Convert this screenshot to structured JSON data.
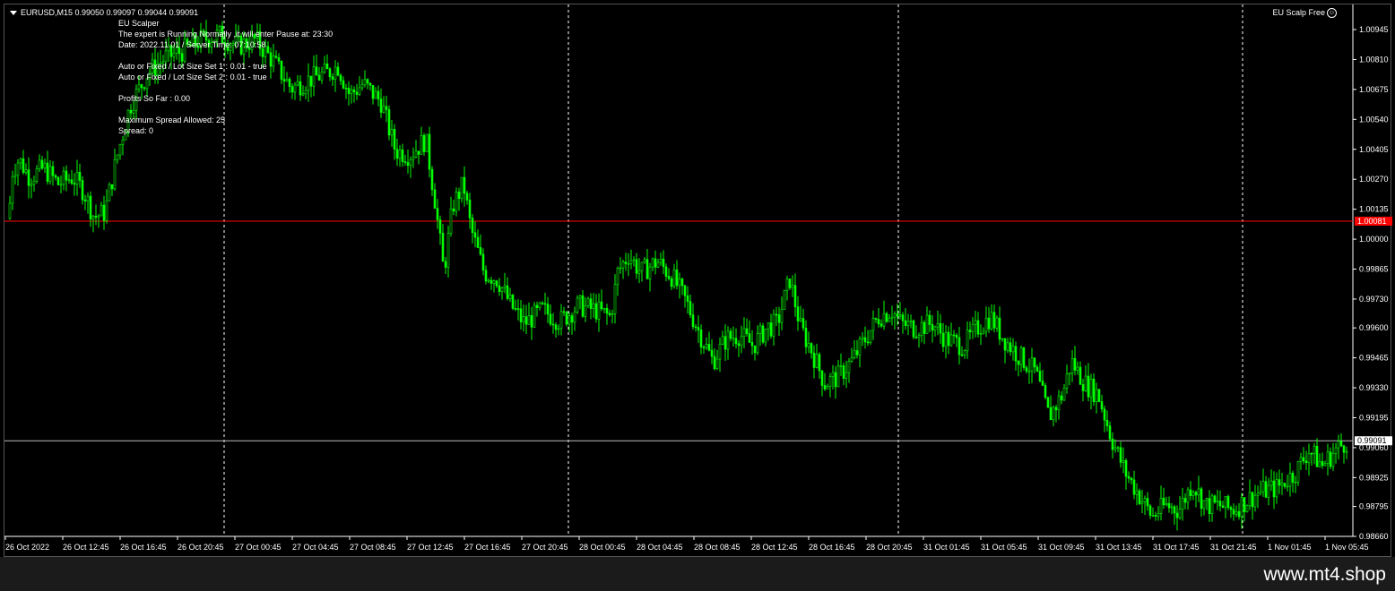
{
  "window": {
    "symbol_title": "EURUSD,M15  0.99050 0.99097 0.99044 0.99091",
    "ea_label": "EU Scalp Free",
    "ea_icon": "smiley-icon"
  },
  "info_panel": {
    "lines": [
      "EU Scalper",
      "The expert is Running Normally ,it will enter Pause at: 23:30",
      "Date: 2022.11.01 / Server Time: 07:10:58",
      "",
      "Auto or Fixed / Lot Size Set 1 : 0.01 - true",
      "Auto or Fixed / Lot Size Set 2 : 0.01 - true",
      "",
      "Profits So Far : 0.00",
      "",
      "Maximum Spread Allowed: 25",
      "Spread: 0"
    ]
  },
  "price_axis": {
    "ticks": [
      "1.00945",
      "1.00810",
      "1.00675",
      "1.00540",
      "1.00405",
      "1.00270",
      "1.00135",
      "1.00000",
      "0.99865",
      "0.99730",
      "0.99600",
      "0.99465",
      "0.99330",
      "0.99195",
      "0.99060",
      "0.98925",
      "0.98795",
      "0.98660"
    ],
    "red_line_label": "1.00081",
    "current_price_label": "0.99091"
  },
  "time_axis": {
    "labels": [
      "26 Oct 2022",
      "26 Oct 12:45",
      "26 Oct 16:45",
      "26 Oct 20:45",
      "27 Oct 00:45",
      "27 Oct 04:45",
      "27 Oct 08:45",
      "27 Oct 12:45",
      "27 Oct 16:45",
      "27 Oct 20:45",
      "28 Oct 00:45",
      "28 Oct 04:45",
      "28 Oct 08:45",
      "28 Oct 12:45",
      "28 Oct 16:45",
      "28 Oct 20:45",
      "31 Oct 01:45",
      "31 Oct 05:45",
      "31 Oct 09:45",
      "31 Oct 13:45",
      "31 Oct 17:45",
      "31 Oct 21:45",
      "1 Nov 01:45",
      "1 Nov 05:45"
    ]
  },
  "colors": {
    "background": "#000000",
    "candles": "#00ff00",
    "red_line": "#ff0000",
    "grid": "#ffffff"
  },
  "chart_data": {
    "type": "candlestick",
    "instrument": "EURUSD",
    "timeframe": "M15",
    "ylim": [
      0.9866,
      1.00945
    ],
    "red_line": 1.00081,
    "current_price": 0.99091,
    "close_path": [
      [
        0,
        0.9975
      ],
      [
        8,
        1.003
      ],
      [
        16,
        1.0036
      ],
      [
        28,
        1.0028
      ],
      [
        44,
        1.0032
      ],
      [
        60,
        1.0025
      ],
      [
        76,
        1.0028
      ],
      [
        88,
        1.0022
      ],
      [
        100,
        1.001
      ],
      [
        112,
        1.0012
      ],
      [
        126,
        1.0038
      ],
      [
        140,
        1.006
      ],
      [
        160,
        1.0075
      ],
      [
        180,
        1.0082
      ],
      [
        200,
        1.0085
      ],
      [
        220,
        1.009
      ],
      [
        240,
        1.0092
      ],
      [
        260,
        1.0087
      ],
      [
        280,
        1.009
      ],
      [
        300,
        1.008
      ],
      [
        320,
        1.0068
      ],
      [
        340,
        1.0072
      ],
      [
        360,
        1.0075
      ],
      [
        372,
        1.0078
      ],
      [
        385,
        1.0065
      ],
      [
        400,
        1.007
      ],
      [
        420,
        1.0062
      ],
      [
        436,
        1.004
      ],
      [
        452,
        1.0038
      ],
      [
        470,
        1.0045
      ],
      [
        480,
        1.0018
      ],
      [
        490,
        0.9985
      ],
      [
        500,
        1.0015
      ],
      [
        512,
        1.0025
      ],
      [
        520,
        1.0005
      ],
      [
        535,
        0.9985
      ],
      [
        550,
        0.9982
      ],
      [
        565,
        0.997
      ],
      [
        580,
        0.9962
      ],
      [
        600,
        0.9968
      ],
      [
        620,
        0.9963
      ],
      [
        640,
        0.997
      ],
      [
        660,
        0.9968
      ],
      [
        676,
        0.9965
      ],
      [
        684,
        0.9985
      ],
      [
        696,
        0.9993
      ],
      [
        710,
        0.9985
      ],
      [
        728,
        0.999
      ],
      [
        745,
        0.9983
      ],
      [
        760,
        0.9972
      ],
      [
        775,
        0.9958
      ],
      [
        790,
        0.9945
      ],
      [
        805,
        0.9955
      ],
      [
        820,
        0.9957
      ],
      [
        835,
        0.9952
      ],
      [
        850,
        0.996
      ],
      [
        862,
        0.9962
      ],
      [
        876,
        0.9982
      ],
      [
        888,
        0.996
      ],
      [
        900,
        0.995
      ],
      [
        915,
        0.9935
      ],
      [
        930,
        0.9938
      ],
      [
        945,
        0.9945
      ],
      [
        960,
        0.9955
      ],
      [
        975,
        0.9965
      ],
      [
        990,
        0.9968
      ],
      [
        1000,
        0.9962
      ],
      [
        1015,
        0.996
      ],
      [
        1035,
        0.9962
      ],
      [
        1050,
        0.9955
      ],
      [
        1070,
        0.9952
      ],
      [
        1085,
        0.996
      ],
      [
        1100,
        0.9965
      ],
      [
        1115,
        0.9955
      ],
      [
        1130,
        0.9948
      ],
      [
        1150,
        0.994
      ],
      [
        1165,
        0.992
      ],
      [
        1180,
        0.993
      ],
      [
        1190,
        0.9945
      ],
      [
        1205,
        0.9935
      ],
      [
        1220,
        0.993
      ],
      [
        1235,
        0.991
      ],
      [
        1250,
        0.9895
      ],
      [
        1265,
        0.9885
      ],
      [
        1280,
        0.9875
      ],
      [
        1295,
        0.988
      ],
      [
        1310,
        0.9878
      ],
      [
        1325,
        0.989
      ],
      [
        1340,
        0.988
      ],
      [
        1355,
        0.988
      ],
      [
        1370,
        0.9878
      ],
      [
        1385,
        0.9882
      ],
      [
        1400,
        0.9886
      ],
      [
        1420,
        0.9888
      ],
      [
        1440,
        0.9895
      ],
      [
        1455,
        0.9905
      ],
      [
        1470,
        0.9898
      ],
      [
        1485,
        0.9905
      ],
      [
        1497,
        0.9909
      ]
    ]
  },
  "footer": {
    "link": "www.mt4.shop"
  }
}
